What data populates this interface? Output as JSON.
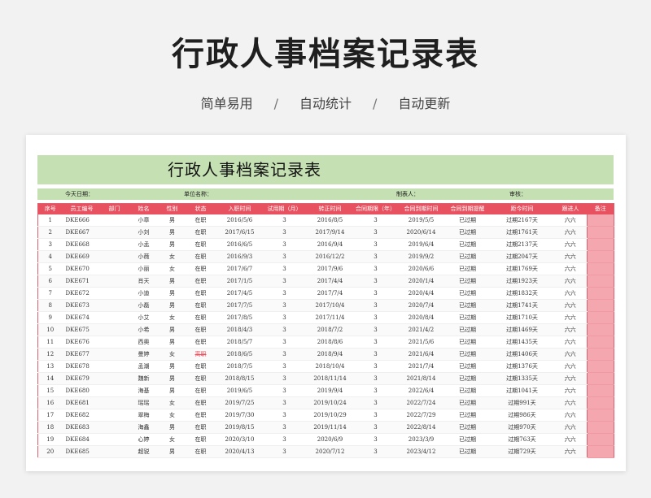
{
  "hero": {
    "title": "行政人事档案记录表",
    "tags": [
      "简单易用",
      "自动统计",
      "自动更新"
    ],
    "separator": "/"
  },
  "sheet": {
    "title": "行政人事档案记录表",
    "info": {
      "today_label": "今天日期：",
      "unit_label": "单位名称：",
      "maker_label": "制表人：",
      "reviewer_label": "审核："
    },
    "columns": [
      "序号",
      "员工编号",
      "部门",
      "姓名",
      "性别",
      "状态",
      "入职时间",
      "试用期（月）",
      "转正时间",
      "合同期限（年）",
      "合同到期时间",
      "合同到期提醒",
      "距今时间",
      "跟进人",
      "备注"
    ],
    "rows": [
      [
        "1",
        "DKE666",
        "",
        "小章",
        "男",
        "在职",
        "2016/5/6",
        "3",
        "2016/8/5",
        "3",
        "2019/5/5",
        "已过期",
        "过期2167天",
        "六六",
        ""
      ],
      [
        "2",
        "DKE667",
        "",
        "小刘",
        "男",
        "在职",
        "2017/6/15",
        "3",
        "2017/9/14",
        "3",
        "2020/6/14",
        "已过期",
        "过期1761天",
        "六六",
        ""
      ],
      [
        "3",
        "DKE668",
        "",
        "小孟",
        "男",
        "在职",
        "2016/6/5",
        "3",
        "2016/9/4",
        "3",
        "2019/6/4",
        "已过期",
        "过期2137天",
        "六六",
        ""
      ],
      [
        "4",
        "DKE669",
        "",
        "小薇",
        "女",
        "在职",
        "2016/9/3",
        "3",
        "2016/12/2",
        "3",
        "2019/9/2",
        "已过期",
        "过期2047天",
        "六六",
        ""
      ],
      [
        "5",
        "DKE670",
        "",
        "小丽",
        "女",
        "在职",
        "2017/6/7",
        "3",
        "2017/9/6",
        "3",
        "2020/6/6",
        "已过期",
        "过期1769天",
        "六六",
        ""
      ],
      [
        "6",
        "DKE671",
        "",
        "肖天",
        "男",
        "在职",
        "2017/1/5",
        "3",
        "2017/4/4",
        "3",
        "2020/1/4",
        "已过期",
        "过期1923天",
        "六六",
        ""
      ],
      [
        "7",
        "DKE672",
        "",
        "小迪",
        "男",
        "在职",
        "2017/4/5",
        "3",
        "2017/7/4",
        "3",
        "2020/4/4",
        "已过期",
        "过期1832天",
        "六六",
        ""
      ],
      [
        "8",
        "DKE673",
        "",
        "小磊",
        "男",
        "在职",
        "2017/7/5",
        "3",
        "2017/10/4",
        "3",
        "2020/7/4",
        "已过期",
        "过期1741天",
        "六六",
        ""
      ],
      [
        "9",
        "DKE674",
        "",
        "小艾",
        "女",
        "在职",
        "2017/8/5",
        "3",
        "2017/11/4",
        "3",
        "2020/8/4",
        "已过期",
        "过期1710天",
        "六六",
        ""
      ],
      [
        "10",
        "DKE675",
        "",
        "小希",
        "男",
        "在职",
        "2018/4/3",
        "3",
        "2018/7/2",
        "3",
        "2021/4/2",
        "已过期",
        "过期1469天",
        "六六",
        ""
      ],
      [
        "11",
        "DKE676",
        "",
        "西奥",
        "男",
        "在职",
        "2018/5/7",
        "3",
        "2018/8/6",
        "3",
        "2021/5/6",
        "已过期",
        "过期1435天",
        "六六",
        ""
      ],
      [
        "12",
        "DKE677",
        "",
        "曼婷",
        "女",
        "离职",
        "2018/6/5",
        "3",
        "2018/9/4",
        "3",
        "2021/6/4",
        "已过期",
        "过期1406天",
        "六六",
        ""
      ],
      [
        "13",
        "DKE678",
        "",
        "孟潮",
        "男",
        "在职",
        "2018/7/5",
        "3",
        "2018/10/4",
        "3",
        "2021/7/4",
        "已过期",
        "过期1376天",
        "六六",
        ""
      ],
      [
        "14",
        "DKE679",
        "",
        "魏新",
        "男",
        "在职",
        "2018/8/15",
        "3",
        "2018/11/14",
        "3",
        "2021/8/14",
        "已过期",
        "过期1335天",
        "六六",
        ""
      ],
      [
        "15",
        "DKE680",
        "",
        "海基",
        "男",
        "在职",
        "2019/6/5",
        "3",
        "2019/9/4",
        "3",
        "2022/6/4",
        "已过期",
        "过期1041天",
        "六六",
        ""
      ],
      [
        "16",
        "DKE681",
        "",
        "瑶瑶",
        "女",
        "在职",
        "2019/7/25",
        "3",
        "2019/10/24",
        "3",
        "2022/7/24",
        "已过期",
        "过期991天",
        "六六",
        ""
      ],
      [
        "17",
        "DKE682",
        "",
        "翠梅",
        "女",
        "在职",
        "2019/7/30",
        "3",
        "2019/10/29",
        "3",
        "2022/7/29",
        "已过期",
        "过期986天",
        "六六",
        ""
      ],
      [
        "18",
        "DKE683",
        "",
        "海鑫",
        "男",
        "在职",
        "2019/8/15",
        "3",
        "2019/11/14",
        "3",
        "2022/8/14",
        "已过期",
        "过期970天",
        "六六",
        ""
      ],
      [
        "19",
        "DKE684",
        "",
        "心婷",
        "女",
        "在职",
        "2020/3/10",
        "3",
        "2020/6/9",
        "3",
        "2023/3/9",
        "已过期",
        "过期763天",
        "六六",
        ""
      ],
      [
        "20",
        "DKE685",
        "",
        "超锐",
        "男",
        "在职",
        "2020/4/13",
        "3",
        "2020/7/12",
        "3",
        "2023/4/12",
        "已过期",
        "过期729天",
        "六六",
        ""
      ]
    ]
  }
}
